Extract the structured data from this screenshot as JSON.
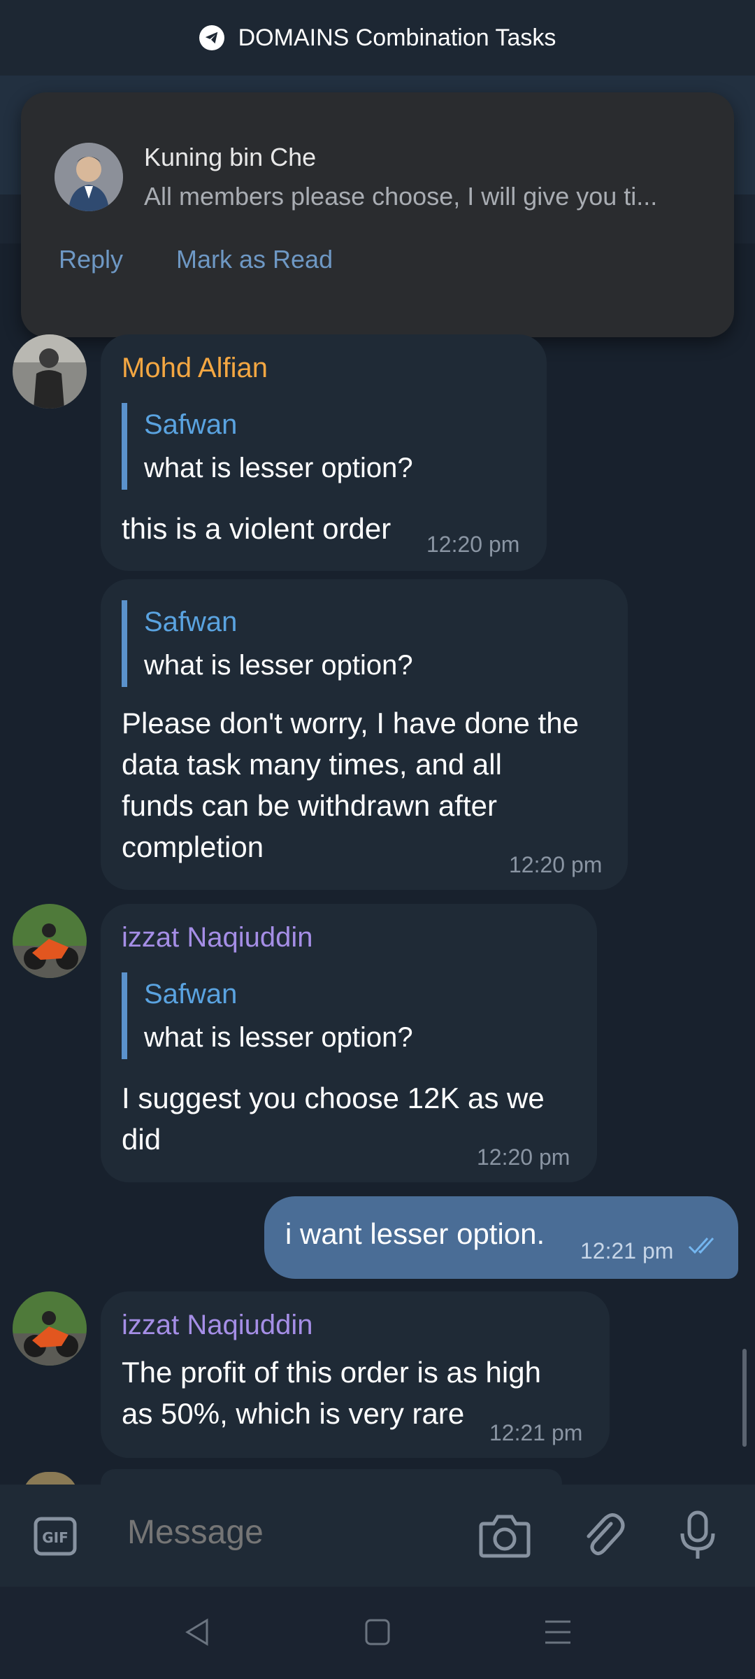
{
  "topbar": {
    "title": "DOMAINS Combination Tasks"
  },
  "notification": {
    "sender": "Kuning bin Che",
    "message": "All members please choose, I will give you ti...",
    "actions": {
      "reply": "Reply",
      "mark_read": "Mark as Read"
    }
  },
  "messages": [
    {
      "sender": "Mohd Alfian",
      "sender_color": "#f4a742",
      "quote": {
        "name": "Safwan",
        "text": "what is lesser option?"
      },
      "body": [
        "this is a violent order"
      ],
      "time": "12:20 pm"
    },
    {
      "quote": {
        "name": "Safwan",
        "text": "what is lesser option?"
      },
      "body": [
        "Please don't worry, I have done the",
        "data task many times, and all",
        "funds can be withdrawn after",
        "completion"
      ],
      "time": "12:20 pm"
    },
    {
      "sender": "izzat Naqiuddin",
      "sender_color": "#a58ee6",
      "quote": {
        "name": "Safwan",
        "text": "what is lesser option?"
      },
      "body": [
        "I suggest you choose 12K as we",
        "did"
      ],
      "time": "12:20 pm"
    },
    {
      "outgoing": true,
      "body": "i want lesser option.",
      "time": "12:21 pm"
    },
    {
      "sender": "izzat Naqiuddin",
      "sender_color": "#a58ee6",
      "body": [
        "The profit of this order is as high",
        "as 50%, which is very rare"
      ],
      "time": "12:21 pm"
    }
  ],
  "composer": {
    "placeholder": "Message"
  },
  "icons": {
    "telegram": "telegram-icon",
    "gif": "gif-icon",
    "camera": "camera-icon",
    "attach": "paperclip-icon",
    "mic": "microphone-icon"
  }
}
